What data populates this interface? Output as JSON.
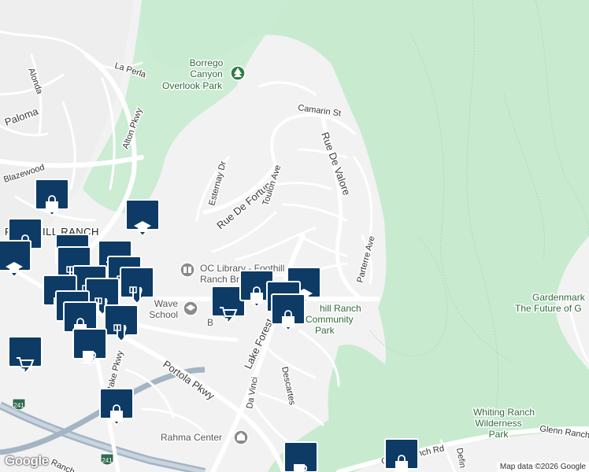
{
  "map": {
    "colors": {
      "land": "#f2f2f2",
      "park": "#c8ebd0",
      "road": "#ffffff",
      "highway": "#a3b4c4",
      "pin": "#0d3b66",
      "parkDot": "#d8efd9"
    },
    "streets": [
      "La Perla",
      "Alonda",
      "Paloma",
      "Alton Pkwy",
      "Blazewood",
      "Esternay Dr",
      "Rue De Fortuna",
      "Toulon Ave",
      "Camarin St",
      "Rue De Valore",
      "Parterre Ave",
      "Lake Forest",
      "Portola Pkwy",
      "Rake Pkwy",
      "Da Vinci",
      "Descartes",
      "Glenn Ranch Rd",
      "Glenn Ranch Rd",
      "Defin",
      "Ranch",
      "241",
      "241"
    ],
    "areas": [
      "FOOTHILL RANCH"
    ],
    "places": [
      {
        "name": "Borrego Canyon Overlook Park",
        "lines": [
          "Borrego",
          "Canyon",
          "Overlook Park"
        ]
      },
      {
        "name": "OC Library - Foothill Ranch Branch",
        "lines": [
          "OC Library - Foothill",
          "Ranch Branch"
        ]
      },
      {
        "name": "Wave School",
        "lines": [
          "Wave",
          "School"
        ]
      },
      {
        "name": "Foothill Ranch Community Park",
        "lines": [
          "hill Ranch",
          "Community",
          "Park"
        ]
      },
      {
        "name": "Gardenmark",
        "lines": [
          "Gardenmark",
          "The Future of G"
        ]
      },
      {
        "name": "Whiting Ranch Wilderness Park",
        "lines": [
          "Whiting Ranch",
          "Wilderness",
          "Park"
        ]
      },
      {
        "name": "Rahma Center",
        "lines": [
          "Rahma Center"
        ]
      },
      {
        "name": "B",
        "lines": [
          "B"
        ]
      }
    ],
    "pins": [
      "shopping-bag-icon",
      "graduation-cap-icon",
      "fork-knife-icon",
      "shopping-cart-icon",
      "coffee-icon"
    ],
    "logo": "Google",
    "attribution": "Map data ©2026 Google"
  }
}
